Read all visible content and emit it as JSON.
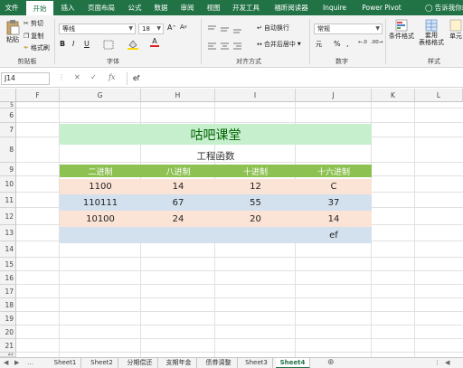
{
  "menu": {
    "tabs": [
      "文件",
      "开始",
      "插入",
      "页面布局",
      "公式",
      "数据",
      "审阅",
      "视图",
      "开发工具",
      "福昕阅读器",
      "Inquire",
      "Power Pivot"
    ],
    "active_tab": "开始",
    "tell_me": "告诉我你想要做"
  },
  "ribbon": {
    "clipboard": {
      "paste": "粘贴",
      "cut": "剪切",
      "copy": "复制",
      "format_painter": "格式刷",
      "label": "剪贴板"
    },
    "font": {
      "name": "等线",
      "size": "18",
      "label": "字体"
    },
    "alignment": {
      "wrap": "自动换行",
      "merge": "合并后居中",
      "label": "对齐方式"
    },
    "number": {
      "format": "常规",
      "percent": "%",
      "comma": ",",
      "label": "数字"
    },
    "styles": {
      "conditional": "条件格式",
      "table_format_1": "套用",
      "table_format_2": "表格格式",
      "cell_styles": "单元",
      "label": "样式"
    }
  },
  "formula_bar": {
    "cell_ref": "J14",
    "fx": "fx",
    "content": "ef"
  },
  "columns": [
    "F",
    "G",
    "H",
    "I",
    "J",
    "K",
    "L"
  ],
  "rows": [
    "5",
    "6",
    "7",
    "8",
    "9",
    "10",
    "11",
    "12",
    "13",
    "14",
    "15",
    "16",
    "17",
    "18",
    "19",
    "20",
    "21",
    "22",
    "23"
  ],
  "sheet": {
    "title": "咕吧课堂",
    "subtitle": "工程函数",
    "headers": [
      "二进制",
      "八进制",
      "十进制",
      "十六进制"
    ],
    "data_rows": [
      [
        "1100",
        "14",
        "12",
        "C"
      ],
      [
        "110111",
        "67",
        "55",
        "37"
      ],
      [
        "10100",
        "24",
        "20",
        "14"
      ],
      [
        "",
        "",
        "",
        "ef"
      ]
    ]
  },
  "colors": {
    "excel_green": "#217346",
    "title_band": "#c6efce",
    "header_band": "#8dc152",
    "peach_band": "#fbe3d6",
    "blue_band": "#d3e1ee",
    "title_text": "#006100"
  },
  "sheet_tabs": [
    "Sheet1",
    "Sheet2",
    "分期偿还",
    "支期年金",
    "债券调整",
    "Sheet3",
    "Sheet4"
  ],
  "active_sheet": "Sheet4"
}
